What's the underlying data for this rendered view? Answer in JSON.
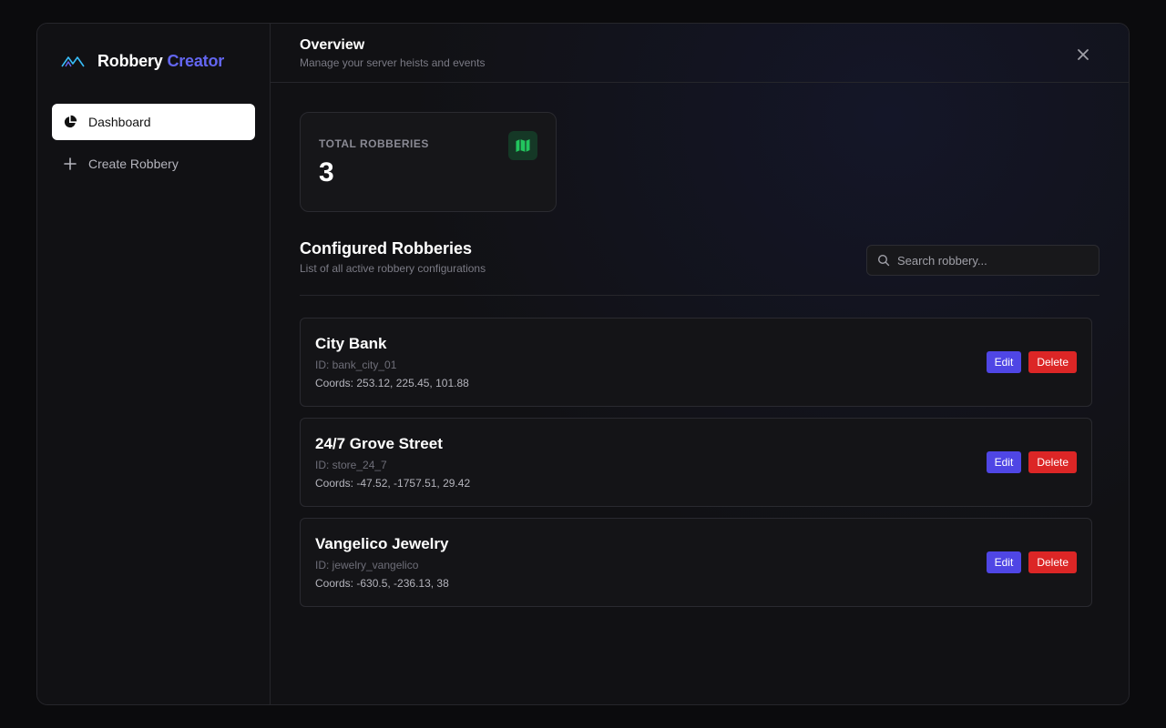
{
  "brand": {
    "name": "Robbery",
    "accent": "Creator",
    "icon": "mountain-icon"
  },
  "sidebar": {
    "items": [
      {
        "label": "Dashboard",
        "icon": "pie-chart-icon",
        "active": true
      },
      {
        "label": "Create Robbery",
        "icon": "plus-icon",
        "active": false
      }
    ]
  },
  "header": {
    "title": "Overview",
    "subtitle": "Manage your server heists and events",
    "close_icon": "close-icon"
  },
  "stats": {
    "label": "TOTAL ROBBERIES",
    "value": "3",
    "icon": "map-icon"
  },
  "section": {
    "title": "Configured Robberies",
    "subtitle": "List of all active robbery configurations"
  },
  "search": {
    "placeholder": "Search robbery...",
    "value": ""
  },
  "robberies": [
    {
      "name": "City Bank",
      "id": "ID: bank_city_01",
      "coords": "Coords: 253.12, 225.45, 101.88"
    },
    {
      "name": "24/7 Grove Street",
      "id": "ID: store_24_7",
      "coords": "Coords: -47.52, -1757.51, 29.42"
    },
    {
      "name": "Vangelico Jewelry",
      "id": "ID: jewelry_vangelico",
      "coords": "Coords: -630.5, -236.13, 38"
    }
  ],
  "buttons": {
    "edit": "Edit",
    "delete": "Delete"
  },
  "colors": {
    "accent": "#6366f1",
    "edit": "#4f46e5",
    "delete": "#dc2626",
    "stat_icon": "#22c55e"
  }
}
